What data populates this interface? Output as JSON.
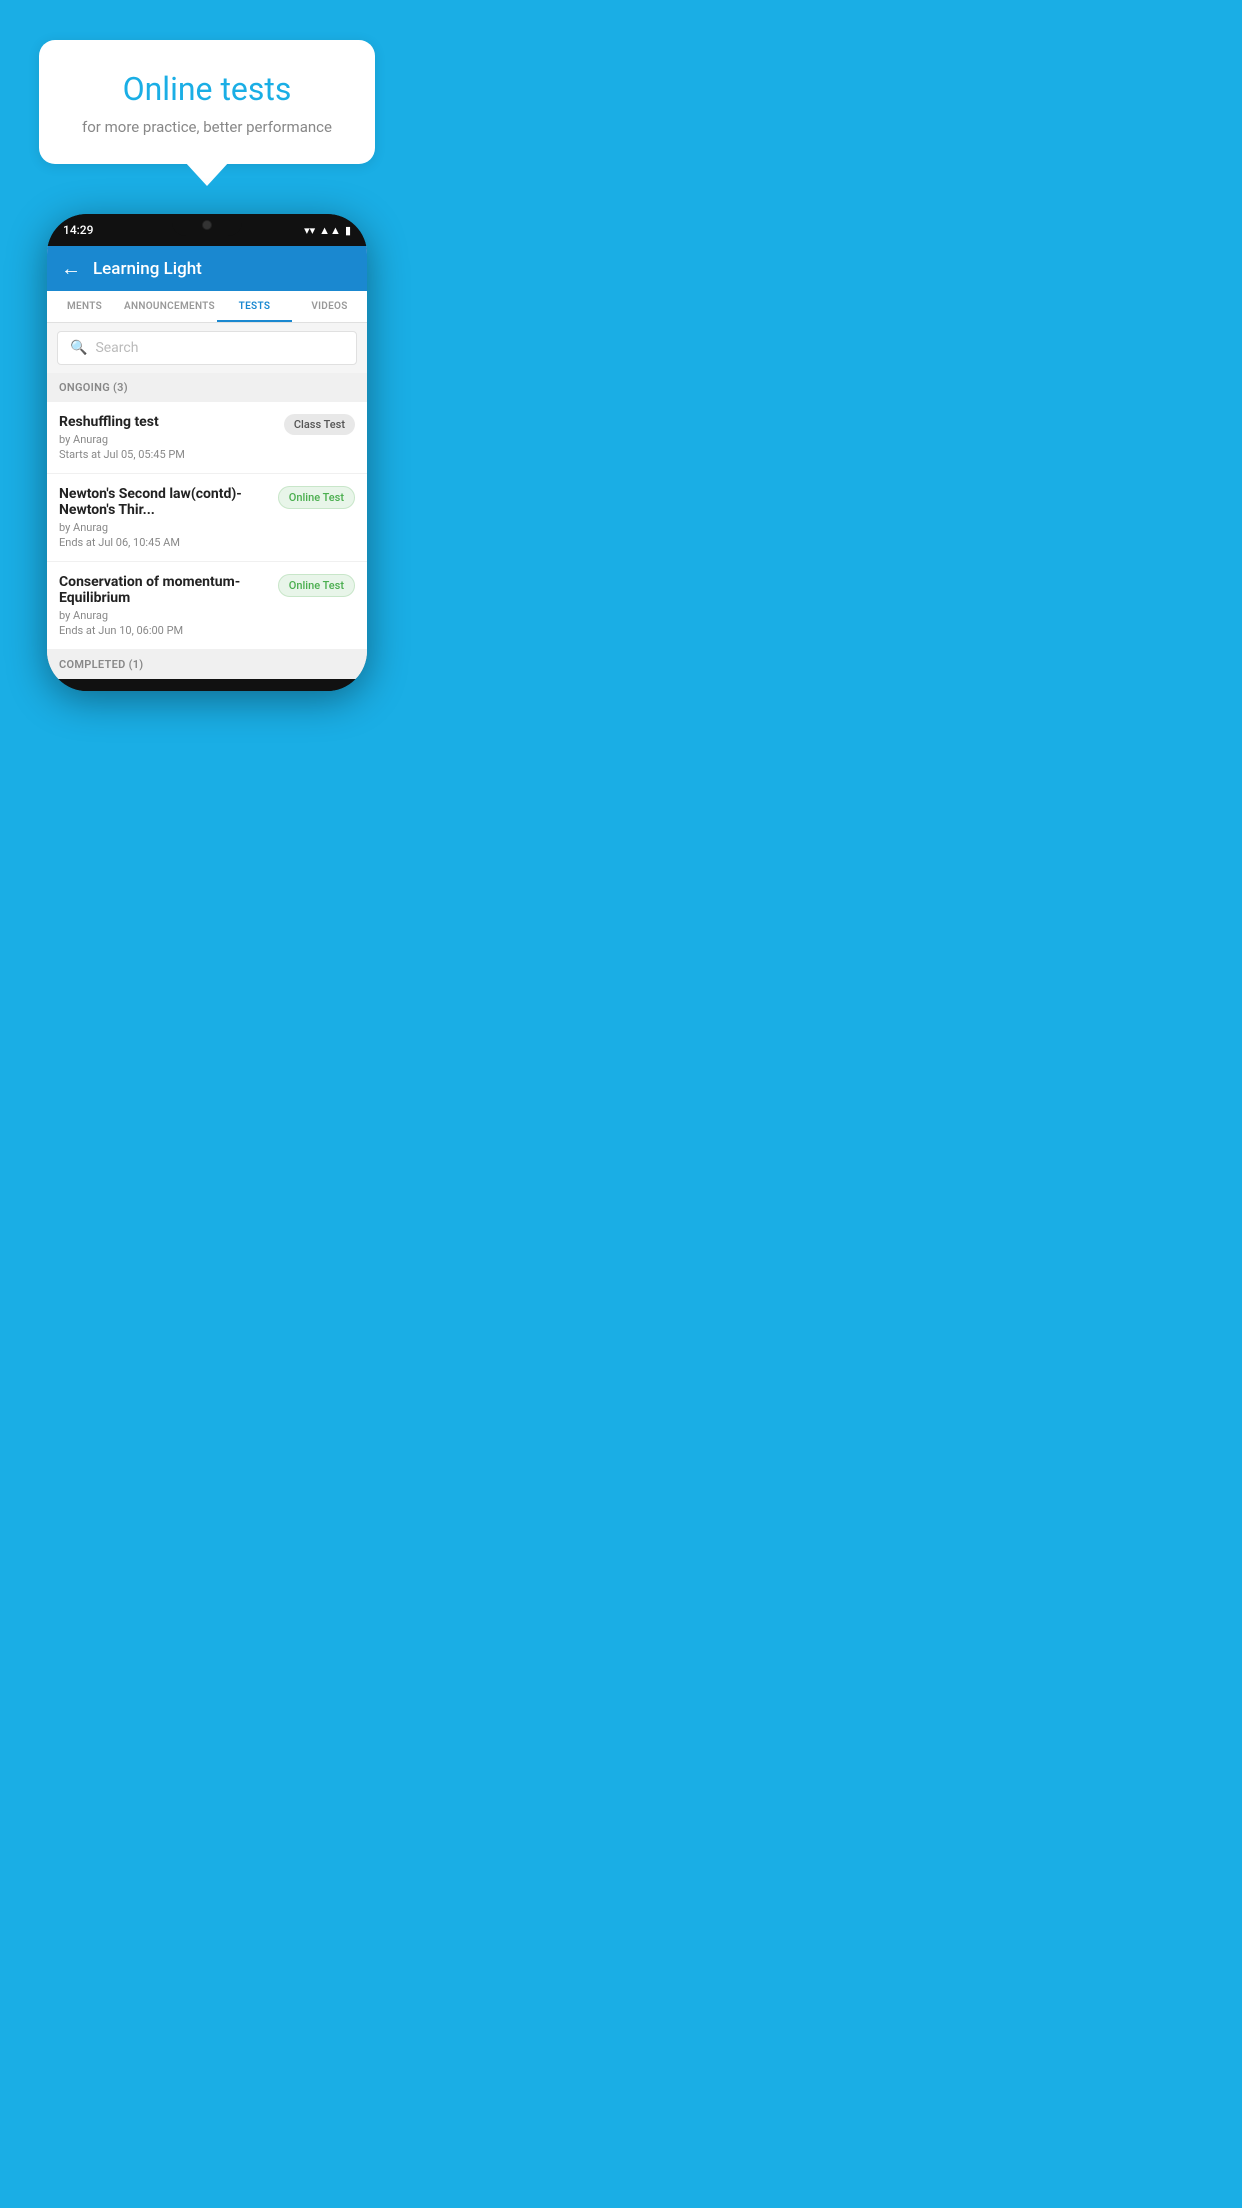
{
  "background_color": "#1AAEE5",
  "bubble": {
    "title": "Online tests",
    "subtitle": "for more practice, better performance"
  },
  "phone": {
    "status_bar": {
      "time": "14:29",
      "wifi": "▼",
      "signal": "▲",
      "battery": "▮"
    },
    "app_bar": {
      "title": "Learning Light",
      "back_label": "←"
    },
    "tabs": [
      {
        "label": "MENTS",
        "active": false
      },
      {
        "label": "ANNOUNCEMENTS",
        "active": false
      },
      {
        "label": "TESTS",
        "active": true
      },
      {
        "label": "VIDEOS",
        "active": false
      }
    ],
    "search": {
      "placeholder": "Search"
    },
    "sections": [
      {
        "label": "ONGOING (3)",
        "items": [
          {
            "name": "Reshuffling test",
            "author": "by Anurag",
            "time_label": "Starts at",
            "time": "Jul 05, 05:45 PM",
            "badge": "Class Test",
            "badge_type": "class"
          },
          {
            "name": "Newton's Second law(contd)-Newton's Thir...",
            "author": "by Anurag",
            "time_label": "Ends at",
            "time": "Jul 06, 10:45 AM",
            "badge": "Online Test",
            "badge_type": "online"
          },
          {
            "name": "Conservation of momentum-Equilibrium",
            "author": "by Anurag",
            "time_label": "Ends at",
            "time": "Jun 10, 06:00 PM",
            "badge": "Online Test",
            "badge_type": "online"
          }
        ]
      },
      {
        "label": "COMPLETED (1)",
        "items": []
      }
    ]
  }
}
